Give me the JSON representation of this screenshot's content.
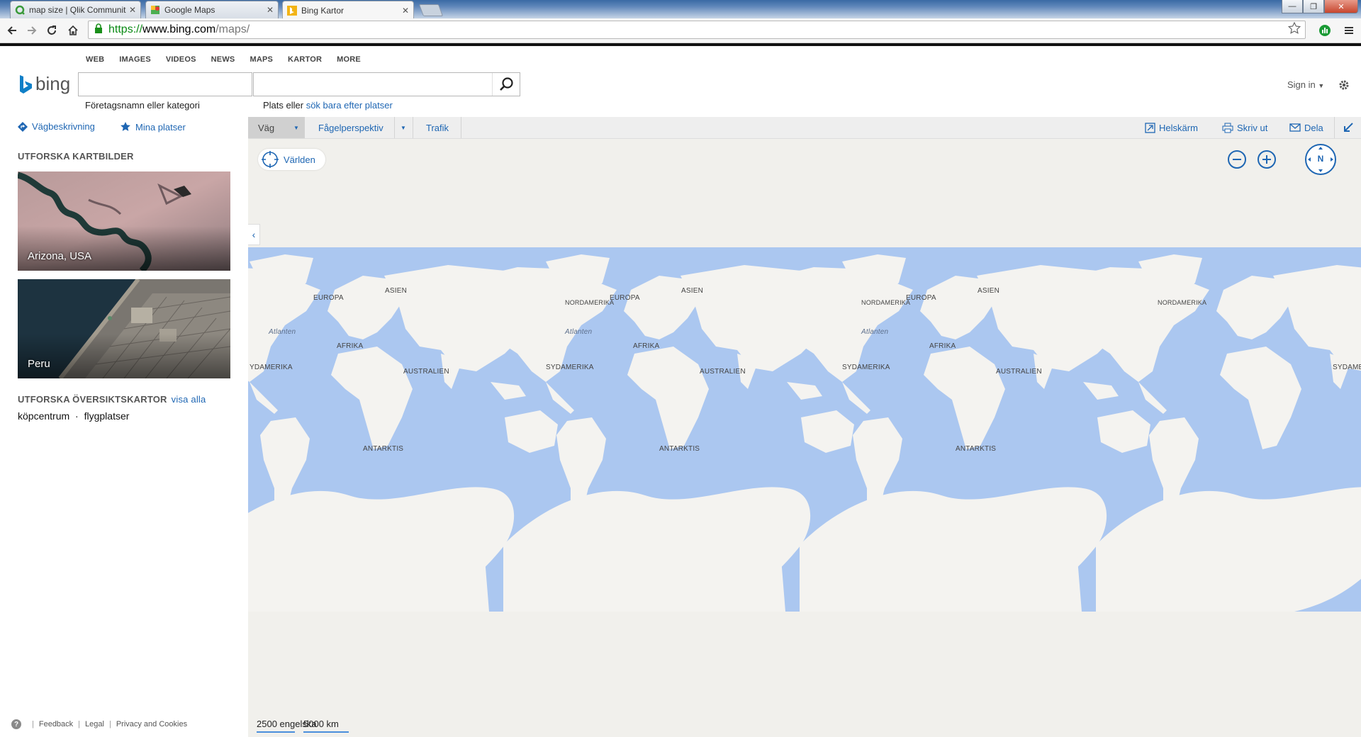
{
  "browser": {
    "tabs": [
      {
        "title": "map size | Qlik Communit",
        "favicon": "qlik-icon"
      },
      {
        "title": "Google Maps",
        "favicon": "google-maps-icon"
      },
      {
        "title": "Bing Kartor",
        "favicon": "bing-icon"
      }
    ],
    "url": {
      "scheme": "https://",
      "host": "www.bing.com",
      "path": "/maps/"
    }
  },
  "bing": {
    "nav": [
      "WEB",
      "IMAGES",
      "VIDEOS",
      "NEWS",
      "MAPS",
      "KARTOR",
      "MORE"
    ],
    "logo_text": "bing",
    "business_hint": "Företagsnamn eller kategori",
    "place_hint_prefix": "Plats eller ",
    "place_hint_link": "sök bara efter platser",
    "signin": "Sign in"
  },
  "subbar": {
    "directions": "Vägbeskrivning",
    "my_places": "Mina platser",
    "road": "Väg",
    "birdseye": "Fågelperspektiv",
    "traffic": "Trafik",
    "fullscreen": "Helskärm",
    "print": "Skriv ut",
    "share": "Dela"
  },
  "leftpane": {
    "explore_title": "UTFORSKA KARTBILDER",
    "thumbnails": [
      {
        "caption": "Arizona, USA"
      },
      {
        "caption": "Peru"
      }
    ],
    "overview_title": "UTFORSKA ÖVERSIKTSKARTOR",
    "overview_link": "visa alla",
    "overview_links": [
      "köpcentrum",
      "flygplatser"
    ],
    "separator": "·",
    "footer": [
      "Feedback",
      "Legal",
      "Privacy and Cookies"
    ]
  },
  "map": {
    "world_button": "Världen",
    "compass": "N",
    "labels": {
      "europe": "EUROPA",
      "asia": "ASIEN",
      "north_america": "NORDAMERIKA",
      "africa": "AFRIKA",
      "south_america": "SYDAMERIKA",
      "south_america_cut": "YDAMERIKA",
      "south_america_cut_right": "SYDAME",
      "australia": "AUSTRALIEN",
      "antarctica": "ANTARKTIS",
      "atlantic": "Atlanten"
    },
    "scale_imperial": "2500 engelska",
    "scale_metric": "5000 km"
  },
  "colors": {
    "ocean": "#abc7f0",
    "land": "#f4f3f0",
    "link": "#1e66b3",
    "bing_accent": "#0f7fc7"
  }
}
